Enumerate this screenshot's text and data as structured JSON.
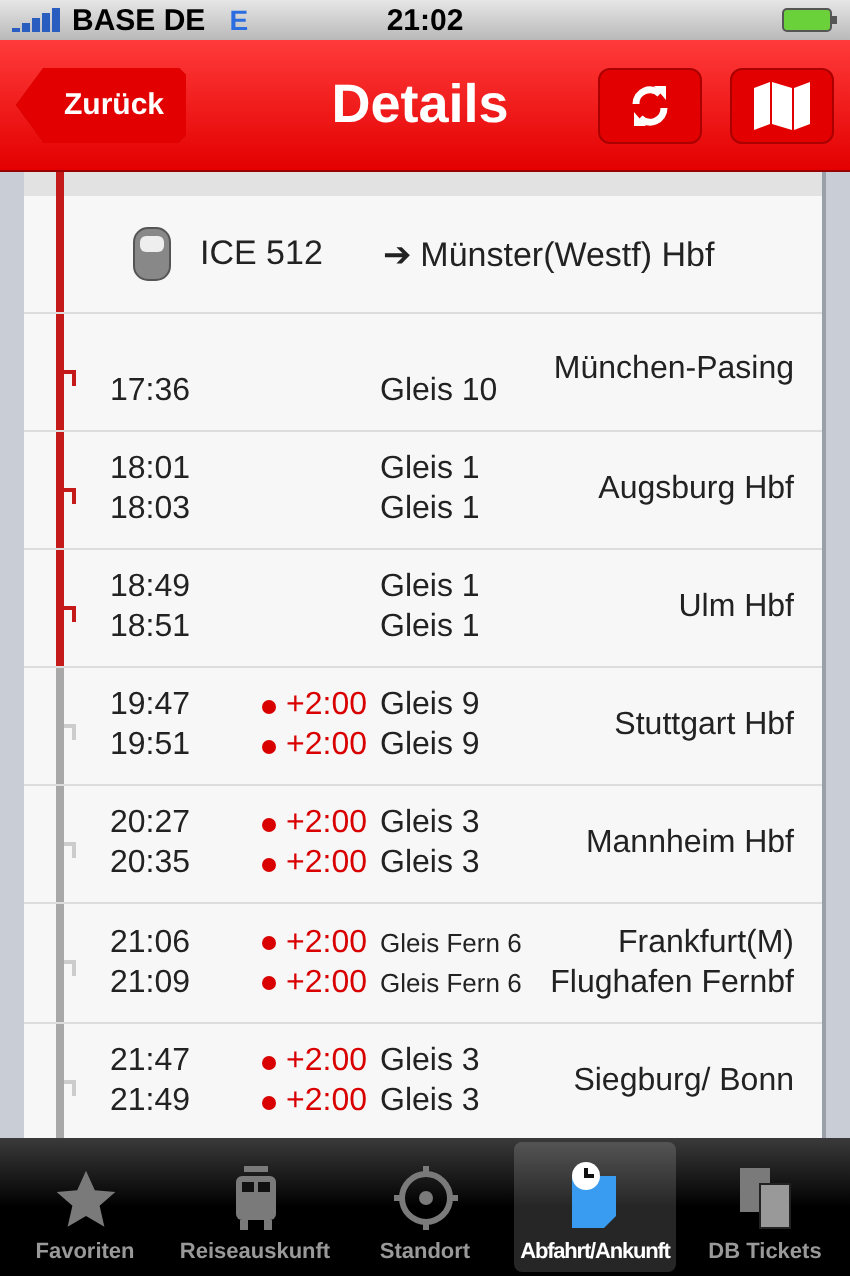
{
  "status_bar": {
    "carrier": "BASE DE",
    "network": "E",
    "time": "21:02"
  },
  "nav": {
    "back": "Zurück",
    "title": "Details"
  },
  "train": {
    "name": "ICE 512",
    "direction": "➔ Münster(Westf) Hbf"
  },
  "stops": [
    {
      "station": "München-Pasing",
      "passed": true,
      "lines": [
        {
          "time": "17:36",
          "track": "Gleis 10"
        }
      ]
    },
    {
      "station": "Augsburg Hbf",
      "passed": true,
      "lines": [
        {
          "time": "18:01",
          "track": "Gleis 1"
        },
        {
          "time": "18:03",
          "track": "Gleis 1"
        }
      ]
    },
    {
      "station": "Ulm Hbf",
      "passed": true,
      "lines": [
        {
          "time": "18:49",
          "track": "Gleis 1"
        },
        {
          "time": "18:51",
          "track": "Gleis 1"
        }
      ]
    },
    {
      "station": "Stuttgart Hbf",
      "passed": false,
      "lines": [
        {
          "time": "19:47",
          "delay": "+2:00",
          "track": "Gleis 9"
        },
        {
          "time": "19:51",
          "delay": "+2:00",
          "track": "Gleis 9"
        }
      ]
    },
    {
      "station": "Mannheim Hbf",
      "passed": false,
      "lines": [
        {
          "time": "20:27",
          "delay": "+2:00",
          "track": "Gleis 3"
        },
        {
          "time": "20:35",
          "delay": "+2:00",
          "track": "Gleis 3"
        }
      ]
    },
    {
      "station": "Frankfurt(M)\nFlughafen Fernbf",
      "passed": false,
      "lines": [
        {
          "time": "21:06",
          "delay": "+2:00",
          "track": "Gleis Fern 6",
          "small": true
        },
        {
          "time": "21:09",
          "delay": "+2:00",
          "track": "Gleis Fern 6",
          "small": true
        }
      ]
    },
    {
      "station": "Siegburg/ Bonn",
      "passed": false,
      "lines": [
        {
          "time": "21:47",
          "delay": "+2:00",
          "track": "Gleis 3"
        },
        {
          "time": "21:49",
          "delay": "+2:00",
          "track": "Gleis 3"
        }
      ]
    }
  ],
  "tabs": [
    {
      "label": "Favoriten",
      "kind": "star",
      "selected": false
    },
    {
      "label": "Reiseauskunft",
      "kind": "train",
      "selected": false
    },
    {
      "label": "Standort",
      "kind": "target",
      "selected": false
    },
    {
      "label": "Abfahrt/Ankunft",
      "kind": "clock",
      "selected": true
    },
    {
      "label": "DB Tickets",
      "kind": "tickets",
      "selected": false
    }
  ]
}
